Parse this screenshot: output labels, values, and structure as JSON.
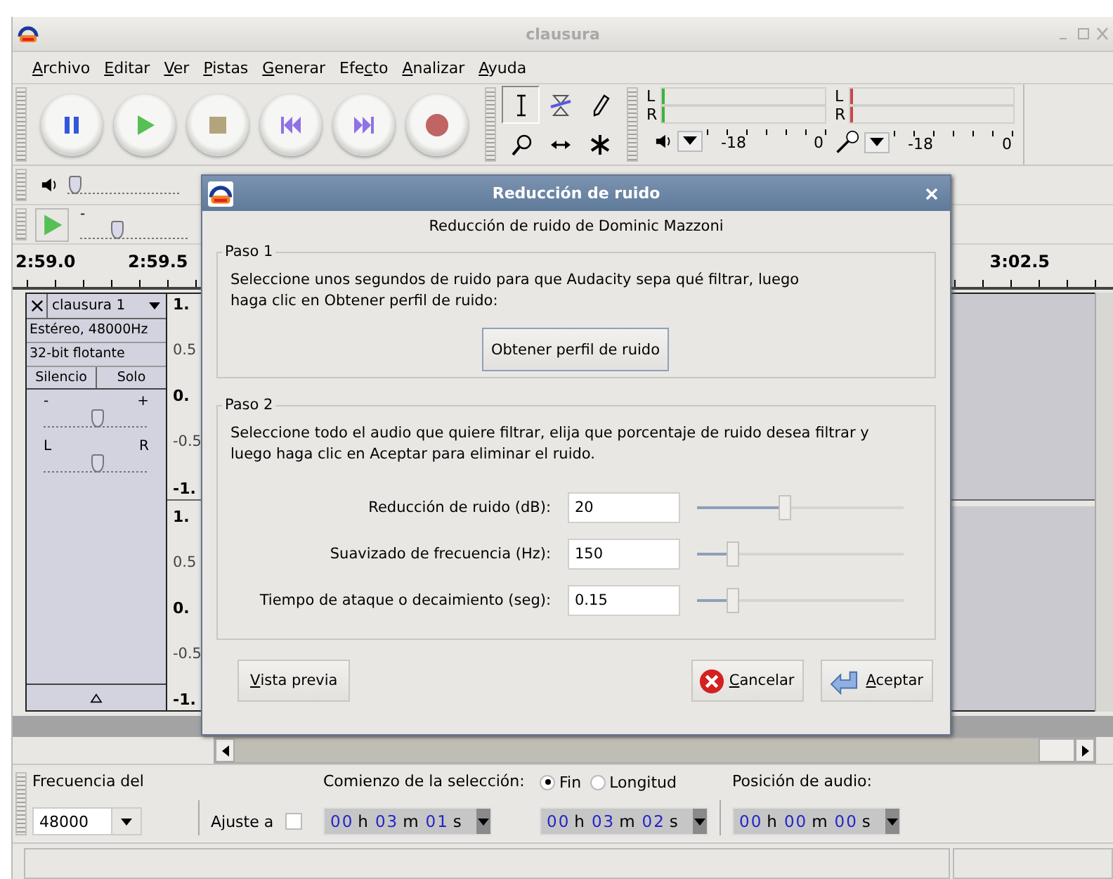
{
  "window": {
    "title": "clausura"
  },
  "menu": [
    {
      "key": "A",
      "post": "rchivo"
    },
    {
      "key": "E",
      "post": "ditar"
    },
    {
      "key": "V",
      "post": "er"
    },
    {
      "key": "P",
      "post": "istas"
    },
    {
      "key": "G",
      "post": "enerar"
    },
    {
      "pre": "Efe",
      "key": "c",
      "post": "to"
    },
    {
      "key": "A",
      "post": "nalizar"
    },
    {
      "key": "A",
      "post": "yuda"
    }
  ],
  "meters": [
    {
      "kind": "playback",
      "channels": [
        "L",
        "R"
      ],
      "color": "#3cb43c",
      "ticks": [
        "-18",
        "0"
      ]
    },
    {
      "kind": "recording",
      "channels": [
        "L",
        "R"
      ],
      "color": "#c84848",
      "ticks": [
        "-18",
        "0"
      ]
    }
  ],
  "mixer": {
    "volume": {
      "level": 0.02
    }
  },
  "speed": {
    "min_label": "-",
    "level": 0.33
  },
  "ruler": [
    "2:59.0",
    "2:59.5",
    "3:02.5"
  ],
  "track": {
    "name": "clausura 1",
    "info": [
      "Estéreo, 48000Hz",
      "32-bit flotante"
    ],
    "mute": "Silencio",
    "solo": "Solo",
    "gain": {
      "min": "-",
      "max": "+",
      "level": 0.5
    },
    "pan": {
      "min": "L",
      "max": "R",
      "level": 0.5
    },
    "channels": [
      {
        "scale": [
          "1.",
          "0.5",
          "0.",
          "-0.5",
          "-1."
        ]
      },
      {
        "scale": [
          "1.",
          "0.5",
          "0.",
          "-0.5",
          "-1."
        ]
      }
    ]
  },
  "dialog": {
    "title": "Reducción de ruido",
    "heading": "Reducción de ruido de Dominic Mazzoni",
    "step1": {
      "legend": "Paso 1",
      "text": "Seleccione unos segundos de ruido para que Audacity sepa qué filtrar, luego haga clic en Obtener perfil de ruido:",
      "button": "Obtener perfil de ruido"
    },
    "step2": {
      "legend": "Paso 2",
      "text": "Seleccione todo el audio que quiere filtrar, elija que porcentaje de ruido desea filtrar y luego haga clic en Aceptar para eliminar el ruido.",
      "params": [
        {
          "label": "Reducción de ruido (dB):",
          "value": "20",
          "level": 0.42
        },
        {
          "label": "Suavizado de frecuencia (Hz):",
          "value": "150",
          "level": 0.17
        },
        {
          "label": "Tiempo de ataque o decaimiento (seg):",
          "value": "0.15",
          "level": 0.17
        }
      ]
    },
    "preview": {
      "key": "V",
      "post": "ista previa"
    },
    "cancel": {
      "key": "C",
      "post": "ancelar"
    },
    "ok": {
      "key": "A",
      "post": "ceptar"
    }
  },
  "selection_bar": {
    "rate_label": "Frecuencia del",
    "rate": "48000",
    "snap_label": "Ajuste a",
    "snap_checked": false,
    "start_label": "Comienzo de la selección:",
    "end_modes": [
      {
        "label": "Fin",
        "selected": true
      },
      {
        "label": "Longitud",
        "selected": false
      }
    ],
    "position_label": "Posición de audio:",
    "times": [
      [
        {
          "digits": "00",
          "unit": "h"
        },
        {
          "digits": "03",
          "unit": "m"
        },
        {
          "digits": "01",
          "unit": "s"
        }
      ],
      [
        {
          "digits": "00",
          "unit": "h"
        },
        {
          "digits": "03",
          "unit": "m"
        },
        {
          "digits": "02",
          "unit": "s"
        }
      ],
      [
        {
          "digits": "00",
          "unit": "h"
        },
        {
          "digits": "00",
          "unit": "m"
        },
        {
          "digits": "00",
          "unit": "s"
        }
      ]
    ]
  }
}
